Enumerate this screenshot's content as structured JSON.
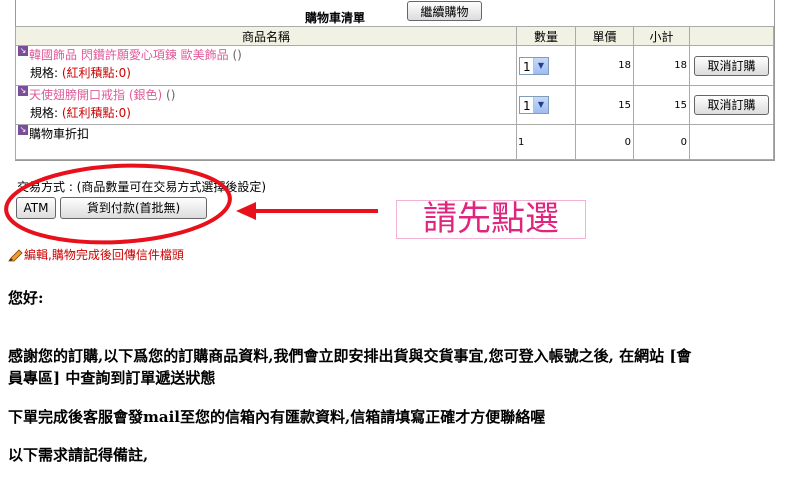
{
  "cart": {
    "title": "購物車清單",
    "continue_label": "繼續購物",
    "headers": [
      "商品名稱",
      "數量",
      "單價",
      "小計",
      ""
    ],
    "items": [
      {
        "name": "韓國飾品 閃鑽許願愛心項鍊 歐美飾品",
        "paren": "()",
        "spec_label": "規格:",
        "spec_value": "(紅利積點:0)",
        "qty": "1",
        "price": "18",
        "subtotal": "18",
        "cancel_label": "取消訂購"
      },
      {
        "name": "天使翅膀開口戒指 (銀色)",
        "paren": "()",
        "spec_label": "規格:",
        "spec_value": "(紅利積點:0)",
        "qty": "1",
        "price": "15",
        "subtotal": "15",
        "cancel_label": "取消訂購"
      }
    ],
    "discount": {
      "name": "購物車折扣",
      "qty": "1",
      "price": "0",
      "subtotal": "0"
    }
  },
  "payment": {
    "label": "交易方式 : (商品數量可在交易方式選擇後設定)",
    "options": [
      "ATM",
      "貨到付款(首批無)"
    ],
    "hint": "請先點選"
  },
  "edit_link": "編輯,購物完成後回傳信件檔頭",
  "body": {
    "greeting": "您好:",
    "p1a": "感謝您的訂購,以下爲您的訂購商品資料,我們會立即安排出貨與交貨事宜,您可登入帳號之後, 在網站 [會",
    "p1b": "員專區] 中查詢到訂單遞送狀態",
    "p2": "下單完成後客服會發mail至您的信箱內有匯款資料,信箱請填寫正確才方便聯絡喔",
    "p3": "以下需求請記得備註,"
  },
  "colors": {
    "annotation_red": "#e8101a",
    "hint_pink": "#e0257f",
    "product_link": "#e05a9a"
  }
}
